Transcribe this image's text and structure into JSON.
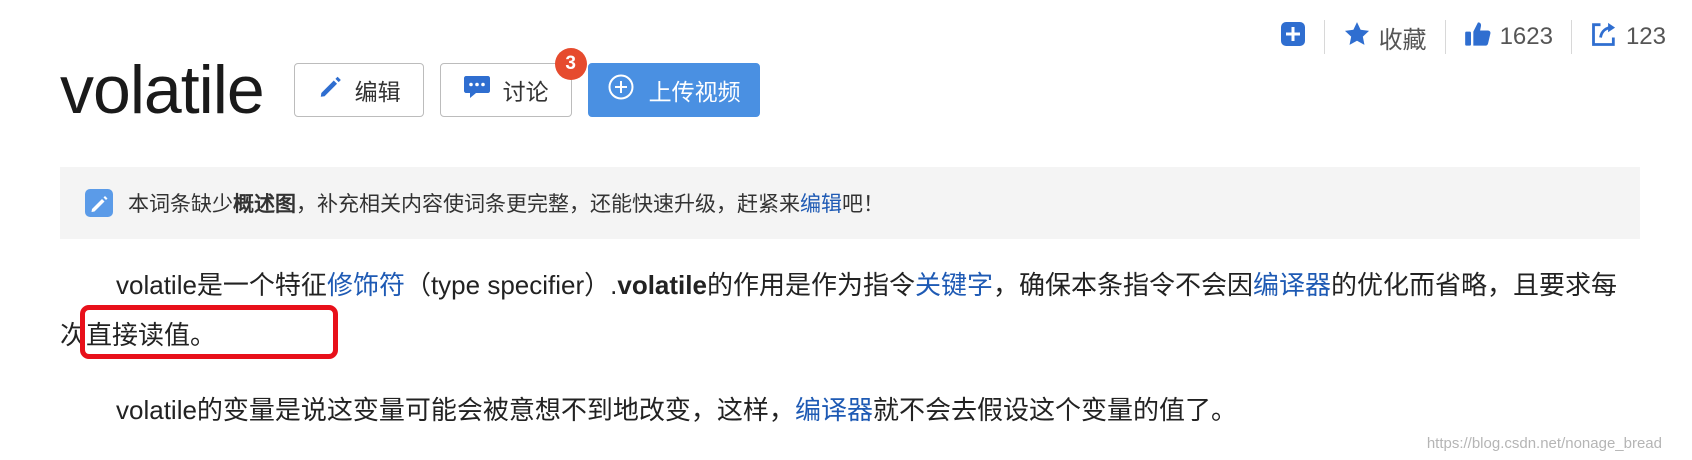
{
  "top_actions": {
    "collect_label": "收藏",
    "like_count": "1623",
    "share_count": "123"
  },
  "title": "volatile",
  "buttons": {
    "edit": "编辑",
    "discuss": "讨论",
    "discuss_badge": "3",
    "upload_video": "上传视频"
  },
  "notice": {
    "pre": "本词条缺少",
    "bold": "概述图",
    "mid": "，补充相关内容使词条更完整，还能快速升级，赶紧来",
    "link": "编辑",
    "post": "吧！"
  },
  "paragraph1": {
    "t1": "volatile是一个特征",
    "link1": "修饰符",
    "t2": "（type specifier）.",
    "bold": "volatile",
    "t3": "的作用是作为指令",
    "link2": "关键字",
    "t4": "，确保本条指令不会因",
    "link3": "编译器",
    "t5": "的优化而省略，且要求每次直接读值。"
  },
  "paragraph2": {
    "t1": "volatile的变量是说这变量可能会被意想不到地改变，这样，",
    "link": "编译器",
    "t2": "就不会去假设这个变量的值了。"
  },
  "watermark": "https://blog.csdn.net/nonage_bread",
  "colors": {
    "link": "#1e5ab4",
    "primary_button": "#4a90e2",
    "badge": "#e64b2e",
    "highlight_box": "#e8101a",
    "action_icon": "#2f6ed0"
  },
  "icons": [
    "plus-square-icon",
    "star-icon",
    "thumbs-up-icon",
    "share-icon",
    "pencil-icon",
    "chat-icon",
    "plus-circle-icon",
    "edit-note-icon"
  ]
}
